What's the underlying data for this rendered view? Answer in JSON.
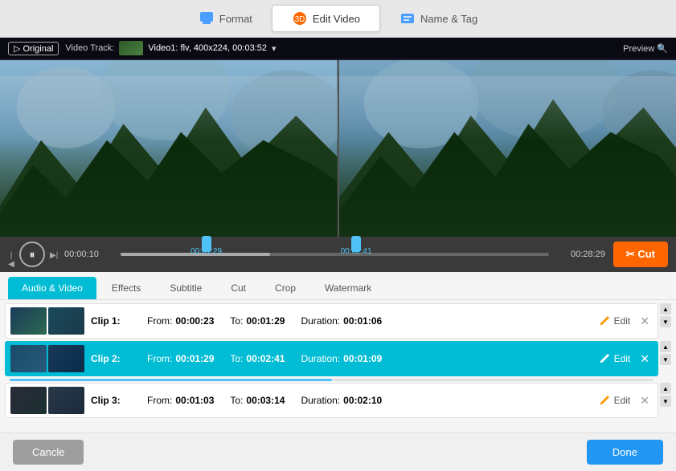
{
  "topTabs": {
    "tabs": [
      {
        "id": "format",
        "label": "Format",
        "active": false
      },
      {
        "id": "edit-video",
        "label": "Edit Video",
        "active": true
      },
      {
        "id": "name-tag",
        "label": "Name & Tag",
        "active": false
      }
    ]
  },
  "videoBar": {
    "originalBadge": "▷ Original",
    "videoTrackLabel": "Video Track:",
    "videoInfo": "Video1: flv, 400x224, 00:03:52",
    "previewLabel": "Preview 🔍"
  },
  "timeline": {
    "currentTime": "00:00:10",
    "handleLeftLabel": "00:01:29",
    "handleRightLabel": "00:02:41",
    "endTime": "00:28:29",
    "cutLabel": "✂ Cut"
  },
  "editTabs": {
    "tabs": [
      {
        "id": "audio-video",
        "label": "Audio & Video",
        "active": true
      },
      {
        "id": "effects",
        "label": "Effects",
        "active": false
      },
      {
        "id": "subtitle",
        "label": "Subtitle",
        "active": false
      },
      {
        "id": "cut",
        "label": "Cut",
        "active": false
      },
      {
        "id": "crop",
        "label": "Crop",
        "active": false
      },
      {
        "id": "watermark",
        "label": "Watermark",
        "active": false
      }
    ]
  },
  "clips": [
    {
      "id": 1,
      "label": "Clip 1:",
      "fromLabel": "From:",
      "fromTime": "00:00:23",
      "toLabel": "To:",
      "toTime": "00:01:29",
      "durationLabel": "Duration:",
      "duration": "00:01:06",
      "editLabel": "Edit",
      "selected": false
    },
    {
      "id": 2,
      "label": "Clip 2:",
      "fromLabel": "From:",
      "fromTime": "00:01:29",
      "toLabel": "To:",
      "toTime": "00:02:41",
      "durationLabel": "Duration:",
      "duration": "00:01:09",
      "editLabel": "Edit",
      "selected": true
    },
    {
      "id": 3,
      "label": "Clip 3:",
      "fromLabel": "From:",
      "fromTime": "00:01:03",
      "toLabel": "To:",
      "toTime": "00:03:14",
      "durationLabel": "Duration:",
      "duration": "00:02:10",
      "editLabel": "Edit",
      "selected": false
    }
  ],
  "bottomBar": {
    "cancelLabel": "Cancle",
    "doneLabel": "Done"
  }
}
